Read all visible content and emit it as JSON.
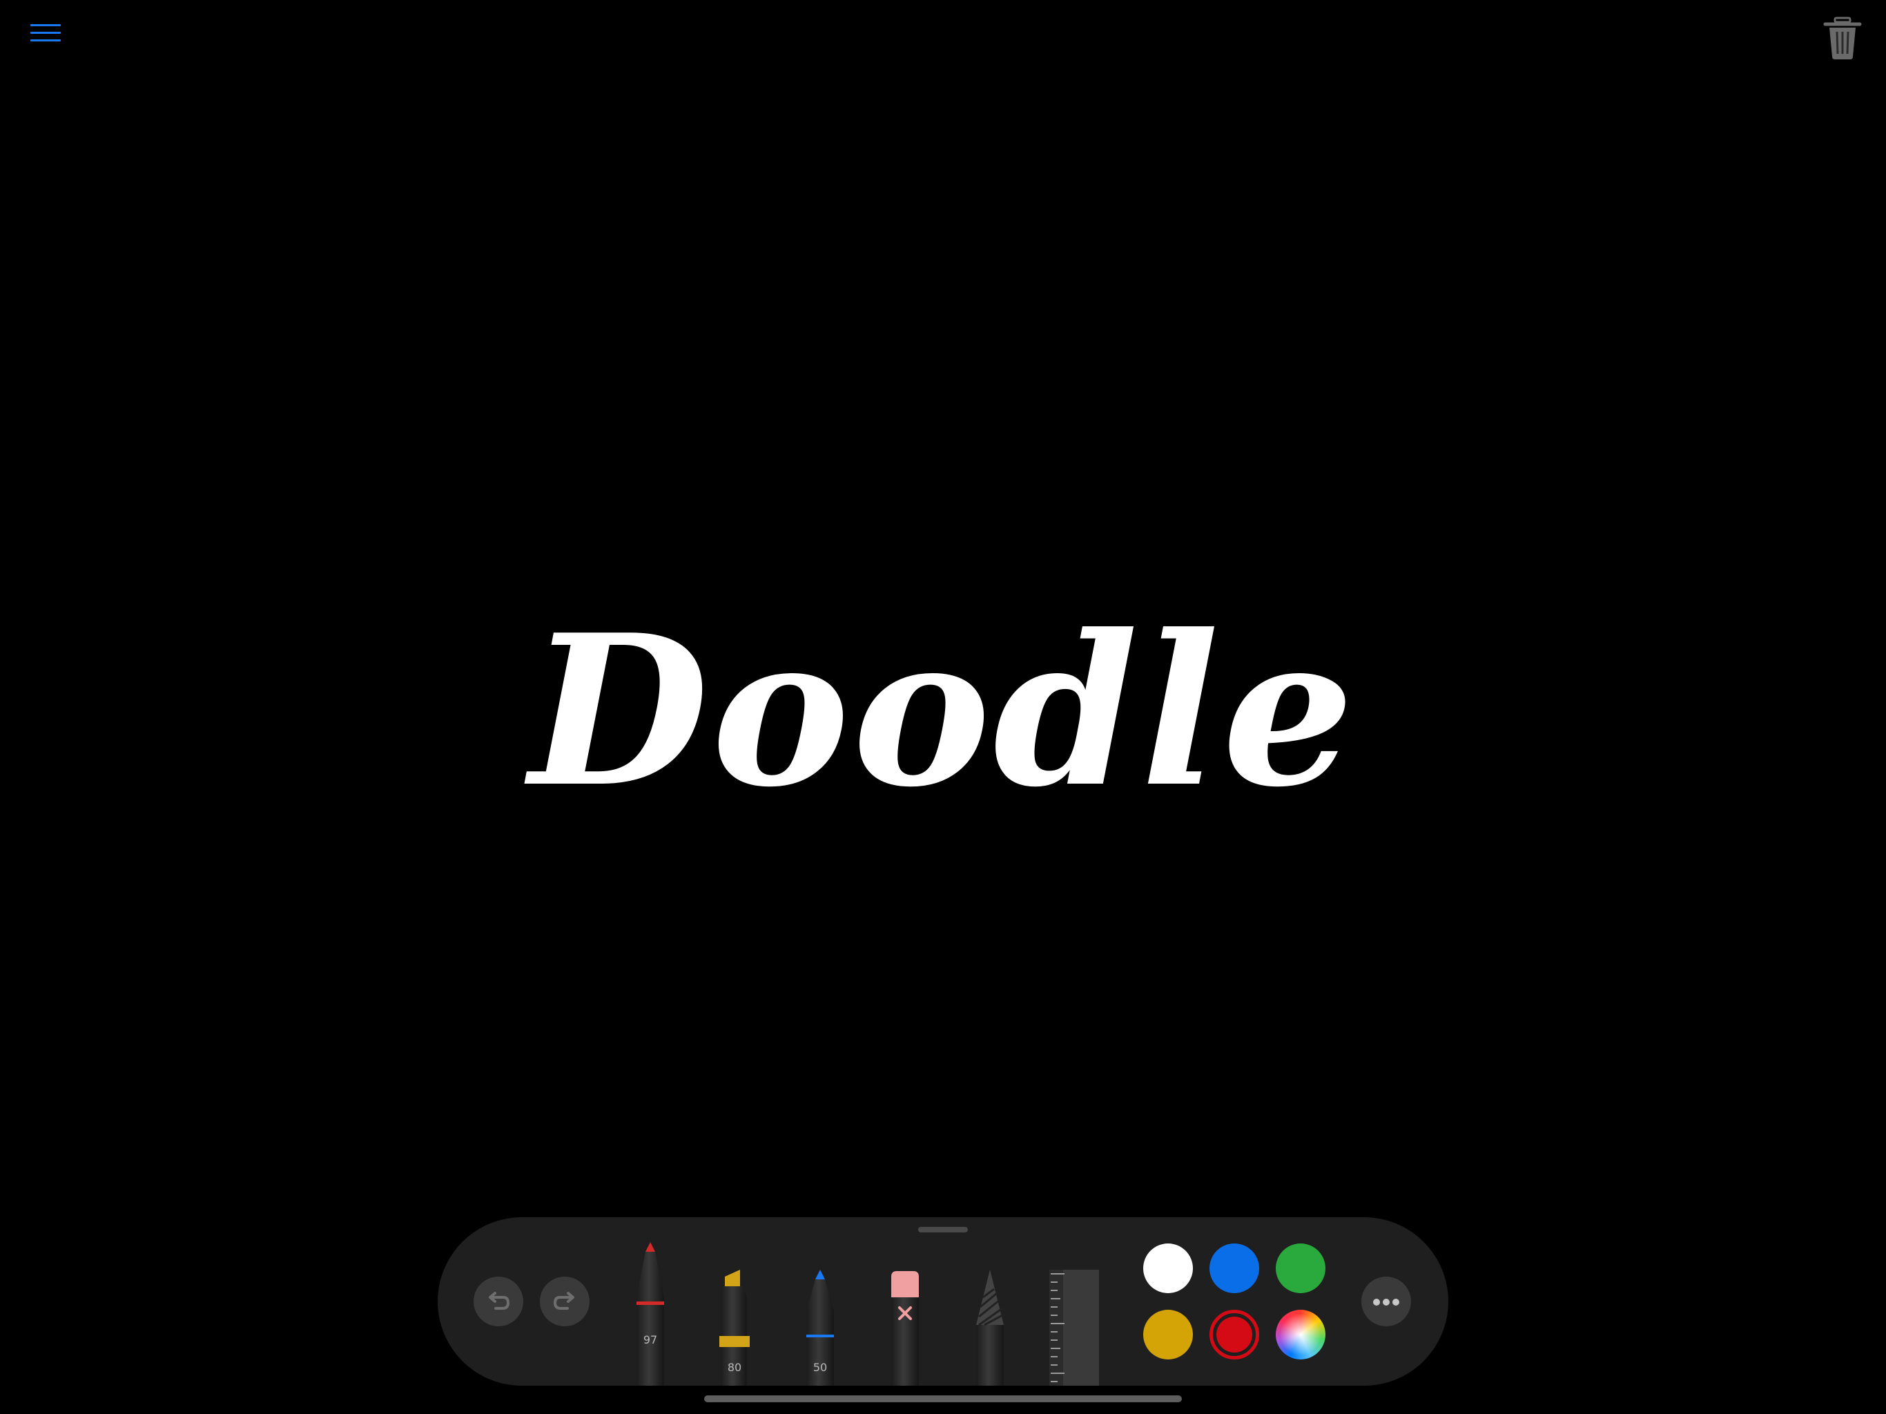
{
  "app": {
    "title": "Doodle"
  },
  "toolbar": {
    "menu_icon": "hamburger-menu-icon",
    "trash_icon": "trash-icon"
  },
  "palette": {
    "undo_icon": "undo-icon",
    "redo_icon": "redo-icon",
    "more_icon": "more-ellipsis-icon",
    "tools": [
      {
        "name": "pen",
        "label": "97",
        "tip_color": "#d42a2a",
        "band_color": "#d42a2a",
        "selected": false
      },
      {
        "name": "marker",
        "label": "80",
        "tip_color": "#d4a418",
        "band_color": "#d4a418",
        "selected": false
      },
      {
        "name": "pencil",
        "label": "50",
        "tip_color": "#1a78f0",
        "band_color": "#1a78f0",
        "selected": false
      },
      {
        "name": "eraser",
        "label": "",
        "tip_color": "#f0a0a0",
        "band_color": "",
        "selected": false
      },
      {
        "name": "lasso",
        "label": "",
        "tip_color": "#555555",
        "band_color": "",
        "selected": false
      },
      {
        "name": "ruler",
        "label": "",
        "tip_color": "",
        "band_color": "",
        "selected": false
      }
    ],
    "colors": [
      {
        "name": "white",
        "hex": "#ffffff",
        "selected": false
      },
      {
        "name": "blue",
        "hex": "#0a6ee8",
        "selected": false
      },
      {
        "name": "green",
        "hex": "#2aaa3c",
        "selected": false
      },
      {
        "name": "yellow",
        "hex": "#d4a406",
        "selected": false
      },
      {
        "name": "red",
        "hex": "#d40a14",
        "selected": true
      },
      {
        "name": "color-picker",
        "hex": "multicolor",
        "selected": false
      }
    ]
  }
}
